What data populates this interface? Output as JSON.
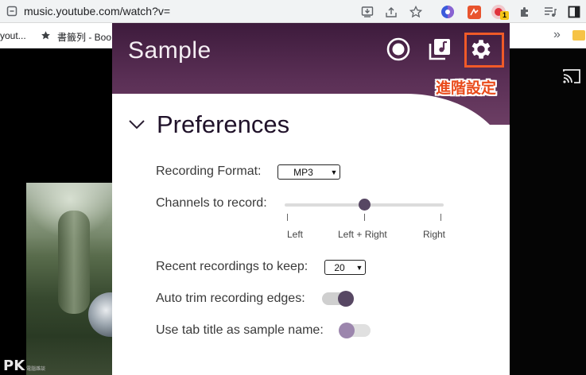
{
  "browser": {
    "url": "music.youtube.com/watch?v=",
    "ext_badge_count": "1"
  },
  "bookmarks": {
    "item1": "yout...",
    "item2": "書籤列 - Boo",
    "overflow": "»"
  },
  "popup": {
    "app_title": "Sample",
    "header_buttons": [
      "record",
      "library",
      "settings"
    ],
    "accent_color": "#574763",
    "highlight_color": "#f05a28"
  },
  "annotation": "進階設定",
  "preferences": {
    "title": "Preferences",
    "recording_format_label": "Recording Format:",
    "recording_format_value": "MP3",
    "channels_label": "Channels to record:",
    "channel_ticks": [
      "Left",
      "Left + Right",
      "Right"
    ],
    "channel_selected": "Left + Right",
    "recent_label": "Recent recordings to keep:",
    "recent_value": "20",
    "auto_trim_label": "Auto trim recording edges:",
    "auto_trim_on": true,
    "tab_title_label": "Use tab title as sample name:",
    "tab_title_on": false
  },
  "watermark": {
    "text": "PK",
    "sub": "電腦雜談"
  }
}
